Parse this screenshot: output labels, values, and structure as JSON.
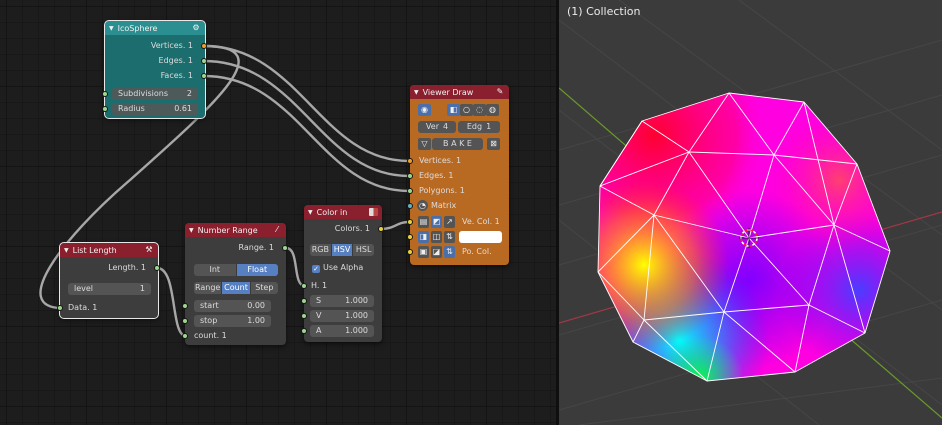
{
  "colors": {
    "icosphere_header": "#2b8f91",
    "icosphere_body": "#1c6d6e",
    "list_length_header": "#8a1f2d",
    "number_range_header": "#8a1f2d",
    "color_in_header": "#8a1f2d",
    "viewer_draw_header": "#8a1f2d",
    "viewer_draw_body": "#b96a22",
    "socket_green": "#9ed690",
    "socket_orange": "#ed9e2b",
    "socket_yellow": "#e8d23a",
    "active_button": "#5680c2"
  },
  "icosphere": {
    "title": "IcoSphere",
    "header_icon": "node-tree-icon",
    "outputs": [
      "Vertices. 1",
      "Edges. 1",
      "Faces. 1"
    ],
    "subdivisions_label": "Subdivisions",
    "subdivisions_value": "2",
    "radius_label": "Radius",
    "radius_value": "0.61"
  },
  "list_length": {
    "title": "List Length",
    "header_icon": "wrench-icon",
    "output": "Length. 1",
    "level_label": "level",
    "level_value": "1",
    "input": "Data. 1"
  },
  "number_range": {
    "title": "Number Range",
    "header_icon": "slash-icon",
    "output": "Range. 1",
    "type_options": [
      "Int",
      "Float"
    ],
    "type_selected": "Float",
    "mode_options": [
      "Range",
      "Count",
      "Step"
    ],
    "mode_selected": "Count",
    "start_label": "start",
    "start_value": "0.00",
    "stop_label": "stop",
    "stop_value": "1.00",
    "count_label": "count. 1"
  },
  "color_in": {
    "title": "Color in",
    "header_icon": "color-swatch-icon",
    "output": "Colors. 1",
    "mode_options": [
      "RGB",
      "HSV",
      "HSL"
    ],
    "mode_selected": "HSV",
    "use_alpha_label": "Use Alpha",
    "use_alpha_checked": true,
    "h_label": "H. 1",
    "s_label": "S",
    "s_value": "1.000",
    "v_label": "V",
    "v_value": "1.000",
    "a_label": "A",
    "a_value": "1.000"
  },
  "viewer_draw": {
    "title": "Viewer Draw",
    "header_icon": "pencil-icon",
    "ver_label": "Ver",
    "ver_value": "4",
    "edg_label": "Edg",
    "edg_value": "1",
    "bake_label": "B A K E",
    "inputs": [
      "Vertices. 1",
      "Edges. 1",
      "Polygons. 1",
      "Matrix"
    ],
    "vecol_label": "Ve. Col. 1",
    "pocol_label": "Po. Col."
  },
  "viewport": {
    "collection_label": "(1) Collection"
  }
}
